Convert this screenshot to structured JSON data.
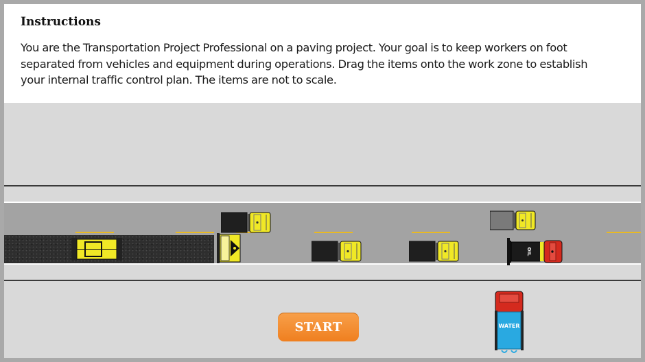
{
  "instructions": {
    "title": "Instructions",
    "body": "You are the Transportation Project Professional on a paving project. Your goal is to keep workers on foot separated from vehicles and equipment during operations. Drag the items onto the work zone to establish your internal traffic control plan. The items are not to scale."
  },
  "start_button": {
    "label": "START"
  },
  "vehicles": {
    "oil_tanker_label": "OIL",
    "water_truck_label": "WATER"
  },
  "colors": {
    "equipment_yellow": "#f0e826",
    "road_gray": "#a3a3a3",
    "shoulder_gray": "#d9d9d9",
    "lane_stripe": "#e8b923",
    "start_orange": "#f29033",
    "water_blue": "#29a9e1",
    "truck_red": "#d42a1e"
  }
}
